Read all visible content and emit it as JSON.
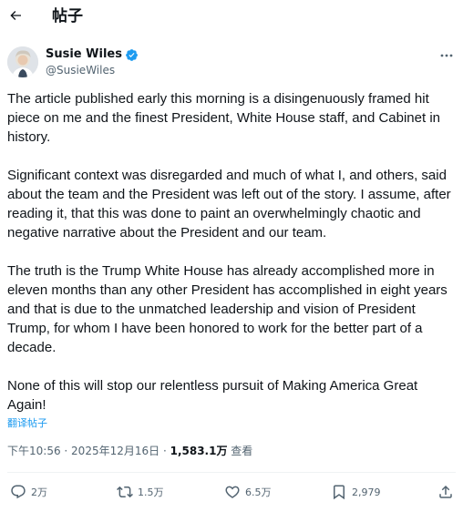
{
  "header": {
    "title": "帖子",
    "back_icon": "arrow-left-icon"
  },
  "author": {
    "display_name": "Susie Wiles",
    "handle": "@SusieWiles",
    "verified_icon": "verified-badge-icon",
    "more_icon": "more-horizontal-icon",
    "verified_color": "#1d9bf0"
  },
  "tweet": {
    "paragraphs": [
      "The article published early this morning is a disingenuously framed hit piece on me and the finest President, White House staff, and Cabinet in history.",
      "Significant context was disregarded and much of what I, and others, said about the team and the President was left out of the story. I assume, after reading it, that this was done to paint an overwhelmingly chaotic and negative narrative about the President and our team.",
      "The truth is the Trump White House has already accomplished more in eleven months than any other President has accomplished in eight years and that is due to the unmatched leadership and vision of President Trump, for whom I have been honored to work for the better part of a decade.",
      "None of this will stop our relentless pursuit of Making America Great Again!"
    ],
    "translate_label": "翻译帖子"
  },
  "meta": {
    "time": "下午10:56",
    "sep1": " · ",
    "date": "2025年12月16日",
    "sep2": " · ",
    "views_count": "1,583.1万",
    "views_label": " 查看"
  },
  "actions": {
    "reply": {
      "icon": "reply-icon",
      "count": "2万"
    },
    "repost": {
      "icon": "repost-icon",
      "count": "1.5万"
    },
    "like": {
      "icon": "heart-icon",
      "count": "6.5万"
    },
    "bookmark": {
      "icon": "bookmark-icon",
      "count": "2,979"
    },
    "share": {
      "icon": "share-icon"
    }
  },
  "colors": {
    "text": "#0f1419",
    "secondary": "#536471",
    "link": "#1d9bf0",
    "divider": "#eff3f4"
  }
}
